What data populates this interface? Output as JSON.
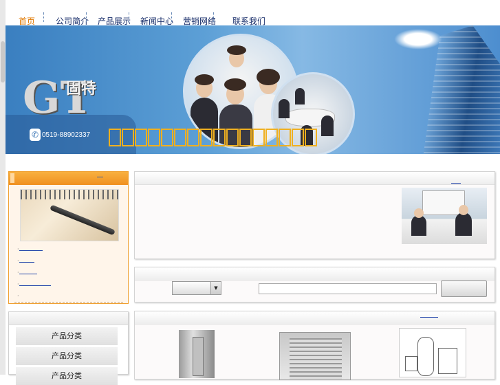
{
  "nav": {
    "items": [
      {
        "label": "首页",
        "active": true
      },
      {
        "label": "公司简介"
      },
      {
        "label": "产品展示"
      },
      {
        "label": "新闻中心"
      },
      {
        "label": "营销网络"
      },
      {
        "label": "联系我们"
      }
    ]
  },
  "banner": {
    "logo_letters": "GT",
    "logo_chinese": "固特",
    "phone": "0519-88902337",
    "phone_icon": "phone-icon",
    "slogan_char_count": 16
  },
  "left_panel_1": {
    "links": [
      "",
      "",
      "",
      ""
    ]
  },
  "left_panel_2": {
    "items": [
      "产品分类",
      "产品分类",
      "产品分类"
    ]
  },
  "colors": {
    "nav_active": "#e07800",
    "nav_text": "#1a2f6b",
    "orange_panel": "#f09020",
    "link": "#2244aa"
  }
}
